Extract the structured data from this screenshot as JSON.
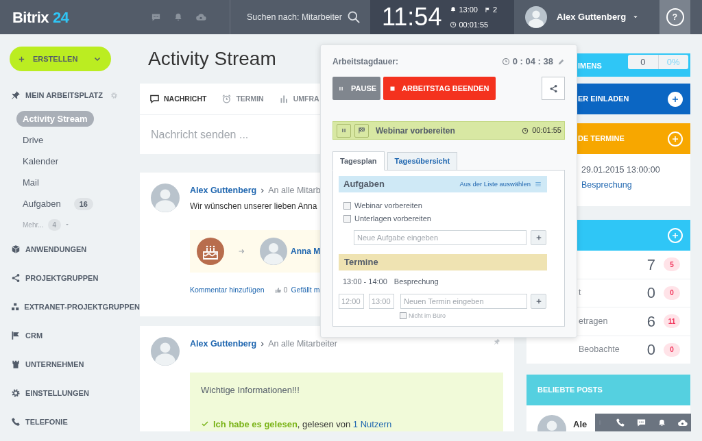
{
  "header": {
    "logo": {
      "name": "Bitrix",
      "suffix": "24"
    },
    "search": {
      "placeholder": "Suchen nach: Mitarbeiter"
    },
    "clock": {
      "time": "11:54",
      "reminder": "13:00",
      "flags": "2",
      "timer": "00:01:55"
    },
    "user": {
      "name": "Alex Guttenberg"
    },
    "help": "?"
  },
  "sidebar": {
    "create_button": "ERSTELLEN",
    "sections": [
      {
        "label": "MEIN ARBEITSPLATZ",
        "settings": true,
        "items": [
          {
            "label": "Activity Stream",
            "selected": true
          },
          {
            "label": "Drive",
            "selected": false
          },
          {
            "label": "Kalender",
            "selected": false
          },
          {
            "label": "Mail",
            "selected": false
          },
          {
            "label": "Aufgaben",
            "selected": false,
            "count": "16"
          }
        ],
        "more": {
          "label": "Mehr...",
          "count": "4"
        }
      },
      {
        "label": "ANWENDUNGEN"
      },
      {
        "label": "PROJEKTGRUPPEN"
      },
      {
        "label": "EXTRANET-PROJEKTGRUPPEN"
      },
      {
        "label": "CRM"
      },
      {
        "label": "UNTERNEHMEN"
      },
      {
        "label": "EINSTELLUNGEN"
      },
      {
        "label": "TELEFONIE"
      }
    ]
  },
  "main": {
    "title": "Activity Stream",
    "composer": {
      "tabs": [
        {
          "label": "NACHRICHT",
          "selected": true
        },
        {
          "label": "TERMIN",
          "selected": false
        },
        {
          "label": "UMFRA",
          "selected": false
        }
      ],
      "placeholder": "Nachricht senden ..."
    },
    "posts": [
      {
        "kind": "birthday",
        "author": "Alex Guttenberg",
        "audience": "An alle Mitarb",
        "text": "Wir wünschen unserer lieben Anna",
        "person": "Anna M",
        "actions": {
          "comment": "Kommentar hinzufügen",
          "likes": "0",
          "like": "Gefällt m"
        }
      },
      {
        "kind": "important",
        "author": "Alex Guttenberg",
        "audience": "An alle Mitarbeiter",
        "message": "Wichtige Informationen!!!",
        "read": {
          "confirm": "Ich habe es gelesen",
          "middle": ", gelesen von ",
          "readers": "1 Nutzern"
        }
      }
    ]
  },
  "right_column": {
    "cards": [
      {
        "kind": "counter",
        "title": "IMENS",
        "color": "#2fc6f6",
        "value": "0",
        "percent": "0%"
      },
      {
        "kind": "action",
        "title": "ER EINLADEN",
        "color": "#0b66c3"
      },
      {
        "kind": "events",
        "title": "DE TERMINE",
        "color": "#f7a700",
        "event": {
          "date": "29.01.2015 13:00:00",
          "name": "Besprechung"
        }
      },
      {
        "kind": "tasks",
        "color": "#2fc6f6",
        "rows": [
          {
            "count": "7",
            "badge": "5"
          },
          {
            "label": "t",
            "count": "0",
            "badge": "0"
          },
          {
            "label": "etragen",
            "count": "6",
            "badge": "11"
          },
          {
            "label": "Beobachte",
            "count": "0",
            "badge": "0"
          }
        ]
      },
      {
        "kind": "popular",
        "title": "BELIEBTE POSTS",
        "color": "#55d0e0",
        "author": "Ale"
      }
    ]
  },
  "popup": {
    "duration_label": "Arbeitstagdauer:",
    "duration": "0 : 04 : 38",
    "buttons": [
      {
        "kind": "pause",
        "label": "PAUSE"
      },
      {
        "kind": "stop",
        "label": "ARBEITSTAG BEENDEN"
      }
    ],
    "current_task": {
      "title": "Webinar vorbereiten",
      "time": "00:01:55"
    },
    "tabs": [
      {
        "label": "Tagesplan",
        "selected": true
      },
      {
        "label": "Tagesübersicht",
        "selected": false
      }
    ],
    "tasks": {
      "title": "Aufgaben",
      "pick_link": "Aus der Liste auswählen",
      "items": [
        {
          "label": "Webinar vorbereiten",
          "checked": false
        },
        {
          "label": "Unterlagen vorbereiten",
          "checked": false
        }
      ],
      "new_placeholder": "Neue Aufgabe eingeben"
    },
    "events": {
      "title": "Termine",
      "items": [
        {
          "time": "13:00 - 14:00",
          "name": "Besprechung"
        }
      ],
      "from_placeholder": "12:00",
      "to_placeholder": "13:00",
      "new_placeholder": "Neuen Termin eingeben",
      "away": {
        "label": "Nicht im Büro",
        "checked": false
      }
    }
  }
}
